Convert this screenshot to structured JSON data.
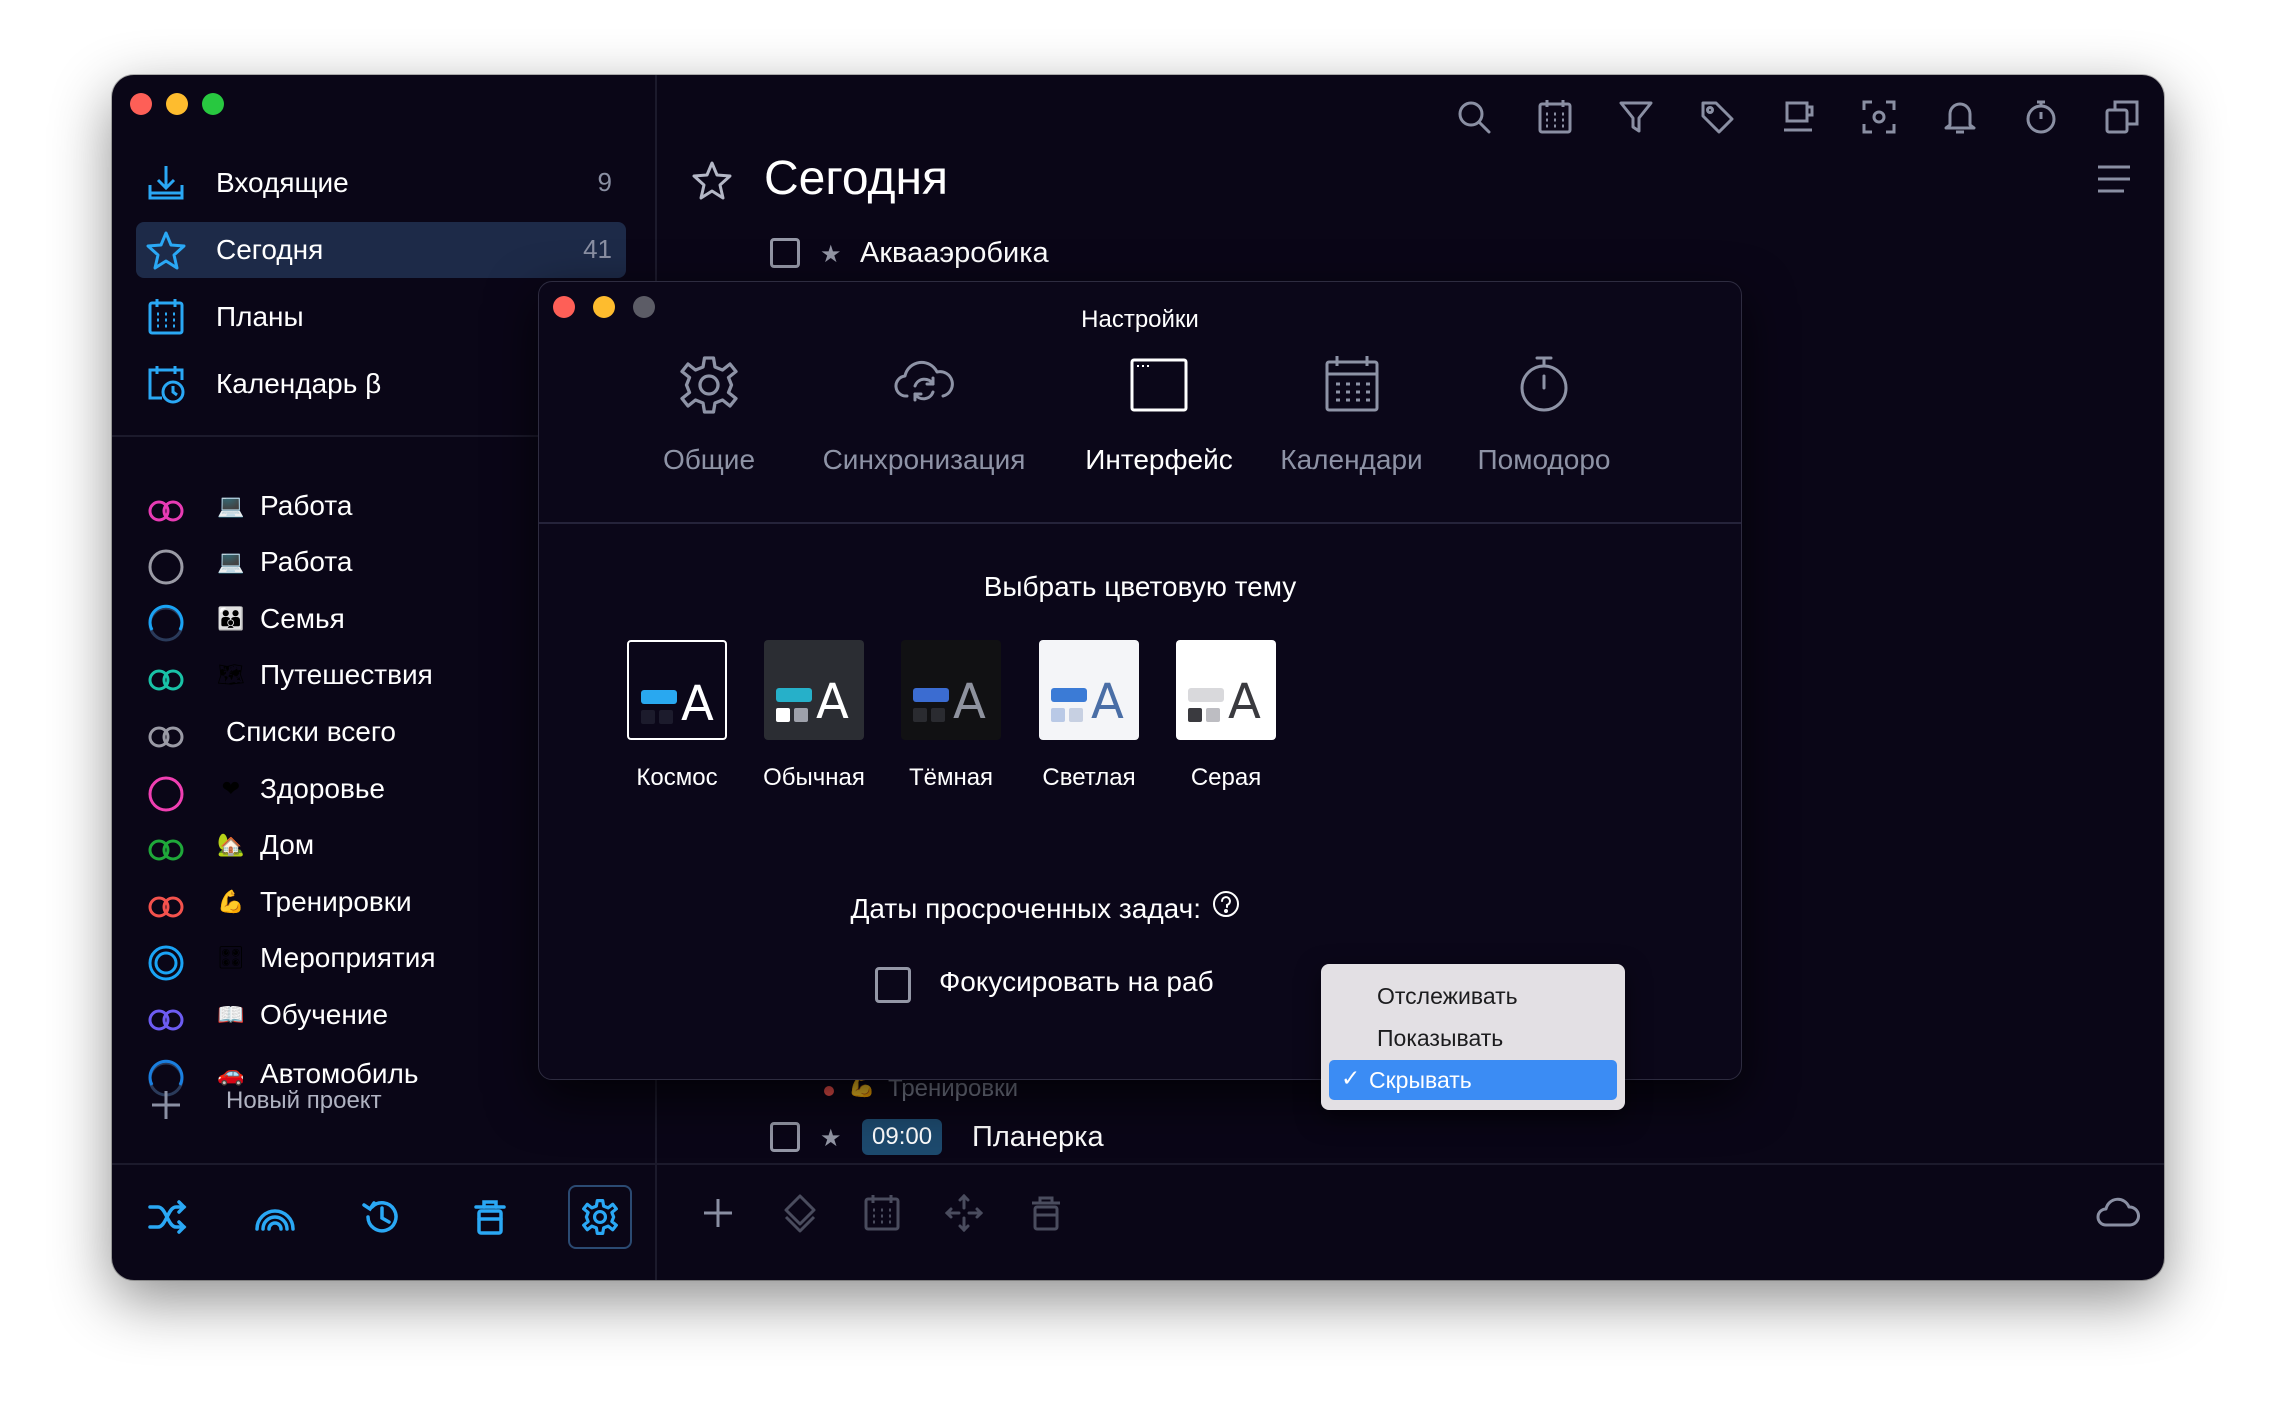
{
  "sidebar": {
    "nav": [
      {
        "label": "Входящие",
        "count": "9"
      },
      {
        "label": "Сегодня",
        "count": "41"
      },
      {
        "label": "Планы",
        "count": ""
      },
      {
        "label": "Календарь β",
        "count": ""
      }
    ],
    "projects": [
      {
        "label": "Работа",
        "emoji": "💻",
        "ring": "#e83bb4"
      },
      {
        "label": "Работа",
        "emoji": "💻",
        "ring": "#9a9aa5"
      },
      {
        "label": "Семья",
        "emoji": "👪",
        "ring": "#1aa3f5"
      },
      {
        "label": "Путешествия",
        "emoji": "🗺",
        "ring": "#19c2a7"
      },
      {
        "label": "Списки всего",
        "emoji": "",
        "ring": "#9a9aa5"
      },
      {
        "label": "Здоровье",
        "emoji": "❤",
        "ring": "#f03fb2"
      },
      {
        "label": "Дом",
        "emoji": "🏡",
        "ring": "#1fa83a"
      },
      {
        "label": "Тренировки",
        "emoji": "💪",
        "ring": "#f4524d"
      },
      {
        "label": "Мероприятия",
        "emoji": "🎛",
        "ring": "#1aa3f5"
      },
      {
        "label": "Обучение",
        "emoji": "📖",
        "ring": "#6d5cf3"
      },
      {
        "label": "Автомобиль",
        "emoji": "🚗",
        "ring": "#1a7fe0"
      }
    ],
    "new_project_label": "Новый проект",
    "toolbar_icons": [
      "shuffle-icon",
      "nearby-icon",
      "history-icon",
      "trash-icon",
      "settings-icon"
    ]
  },
  "main": {
    "title": "Сегодня",
    "tasks": [
      {
        "title": "Аквааэробика"
      },
      {
        "title": "Планерка",
        "time": "09:00"
      }
    ],
    "task_project_tag": "Тренировки",
    "task_project_emoji": "💪",
    "top_icons": [
      "search-icon",
      "calendar-icon",
      "filter-icon",
      "tag-icon",
      "cup-icon",
      "focus-icon",
      "bell-icon",
      "timer-icon",
      "copy-icon"
    ],
    "bottom_icons": [
      "add-icon",
      "priority-icon",
      "calendar-icon",
      "move-icon",
      "delete-icon",
      "cloud-icon"
    ]
  },
  "settings": {
    "title": "Настройки",
    "tabs": [
      {
        "label": "Общие"
      },
      {
        "label": "Синхронизация"
      },
      {
        "label": "Интерфейс"
      },
      {
        "label": "Календари"
      },
      {
        "label": "Помодоро"
      }
    ],
    "active_tab": "Интерфейс",
    "theme_heading": "Выбрать цветовую тему",
    "themes": [
      {
        "label": "Космос",
        "bg": "#0b0719",
        "bar": "#29a8f0",
        "sq1": "#1c1b2c",
        "sq2": "#1c1b2c",
        "letter": "#ffffff"
      },
      {
        "label": "Обычная",
        "bg": "#2b2d33",
        "bar": "#26b0c9",
        "sq1": "#ffffff",
        "sq2": "#9ea1ab",
        "letter": "#ffffff"
      },
      {
        "label": "Тёмная",
        "bg": "#111113",
        "bar": "#3b6cd1",
        "sq1": "#2a2b30",
        "sq2": "#2a2b30",
        "letter": "#8e929e"
      },
      {
        "label": "Светлая",
        "bg": "#f4f5f8",
        "bar": "#3b7bd6",
        "sq1": "#b9c9e6",
        "sq2": "#c7d0e2",
        "letter": "#4a6ea6"
      },
      {
        "label": "Серая",
        "bg": "#ffffff",
        "bar": "#d9d9dc",
        "sq1": "#3a3a3f",
        "sq2": "#bdbdc2",
        "letter": "#3a3a3f"
      }
    ],
    "overdue_label": "Даты просроченных задач:",
    "focus_label": "Фокусировать на раб",
    "dropdown": {
      "options": [
        "Отслеживать",
        "Показывать",
        "Скрывать"
      ],
      "selected": "Скрывать",
      "check": "✓"
    }
  }
}
